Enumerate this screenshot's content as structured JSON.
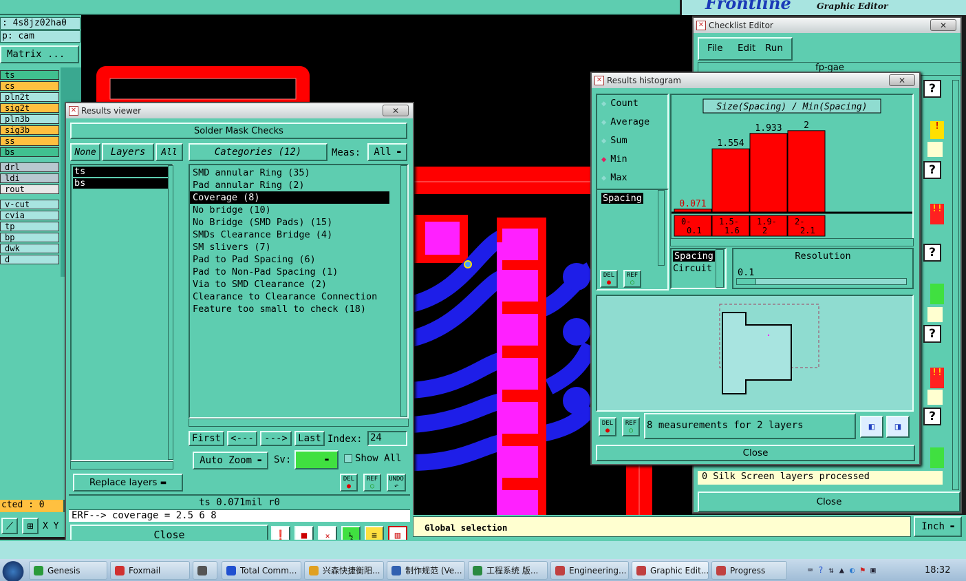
{
  "top_bar": {
    "product": "Frontline",
    "subtitle": "Graphic Editor"
  },
  "left_panel": {
    "job": ": 4s8jz02ha0",
    "step": "p: cam",
    "matrix_button": "Matrix ...",
    "layers": [
      {
        "name": "ts",
        "color": "#40c090"
      },
      {
        "name": "cs",
        "color": "#ffc040"
      },
      {
        "name": "pln2t",
        "color": "#a8e4e0"
      },
      {
        "name": "sig2t",
        "color": "#ffc040"
      },
      {
        "name": "pln3b",
        "color": "#a8e4e0"
      },
      {
        "name": "sig3b",
        "color": "#ffc040"
      },
      {
        "name": "ss",
        "color": "#ffc040"
      },
      {
        "name": "bs",
        "color": "#40c090"
      },
      {
        "name": "drl",
        "color": "#b8c8d0"
      },
      {
        "name": "ldi",
        "color": "#b8c8d0"
      },
      {
        "name": "rout",
        "color": "#e8e8e8"
      },
      {
        "name": "v-cut",
        "color": "#a8e4e0"
      },
      {
        "name": "cvia",
        "color": "#a8e4e0"
      },
      {
        "name": "tp",
        "color": "#a8e4e0"
      },
      {
        "name": "bp",
        "color": "#a8e4e0"
      },
      {
        "name": "dwk",
        "color": "#a8e4e0"
      },
      {
        "name": "d",
        "color": "#a8e4e0"
      }
    ],
    "selected_count": "cted : 0",
    "xy_label": "X Y"
  },
  "results_viewer": {
    "title": "Results viewer",
    "header": "Solder Mask Checks",
    "none_btn": "None",
    "layers_btn": "Layers",
    "all_btn": "All",
    "layers": [
      "ts",
      "bs"
    ],
    "categories_btn": "Categories (12)",
    "meas_label": "Meas:",
    "meas_value": "All",
    "categories": [
      "SMD annular Ring (35)",
      "Pad annular Ring (2)",
      "Coverage (8)",
      "No bridge (10)",
      "No Bridge (SMD Pads) (15)",
      "SMDs Clearance Bridge (4)",
      "SM slivers (7)",
      "Pad to Pad Spacing (6)",
      "Pad to Non-Pad Spacing (1)",
      "Via to SMD Clearance (2)",
      "Clearance to Clearance Connection",
      "Feature too small to check (18)"
    ],
    "selected_category": "Coverage (8)",
    "first_btn": "First",
    "prev_btn": "<---",
    "next_btn": "--->",
    "last_btn": "Last",
    "index_label": "Index:",
    "index_value": "24",
    "zoom_btn": "Auto Zoom",
    "sv_label": "Sv:",
    "show_all": "Show All",
    "replace_btn": "Replace layers",
    "del_label": "DEL",
    "ref_label": "REF",
    "undo_label": "UNDO",
    "status": "ts 0.071mil  r0",
    "erf_line": "ERF--> coverage = 2.5 6 8",
    "close_btn": "Close"
  },
  "histogram": {
    "title": "Results histogram",
    "modes": [
      "Count",
      "Average",
      "Sum",
      "Min",
      "Max"
    ],
    "selected_mode": "Min",
    "list_items": [
      "Spacing"
    ],
    "chart_title": "Size(Spacing) / Min(Spacing)",
    "chart_data": {
      "type": "bar",
      "title": "Size(Spacing) / Min(Spacing)",
      "categories": [
        "0-0.1",
        "1.5-1.6",
        "1.9-2",
        "2-2.1"
      ],
      "values": [
        0.071,
        1.554,
        1.933,
        2
      ],
      "value_labels": [
        "0.071",
        "1.554",
        "1.933",
        "2"
      ],
      "ylim": [
        0,
        2.2
      ]
    },
    "bin_labels": [
      [
        "0-",
        "0.1"
      ],
      [
        "1.5-",
        "1.6"
      ],
      [
        "1.9-",
        "2"
      ],
      [
        "2-",
        "2.1"
      ]
    ],
    "prop_items": [
      "Spacing",
      "Circuit"
    ],
    "resolution_label": "Resolution",
    "resolution_value": "0.1",
    "measurements": "8 measurements for 2 layers",
    "close_btn": "Close",
    "del_label": "DEL",
    "ref_label": "REF"
  },
  "checklist": {
    "title": "Checklist Editor",
    "menus": [
      "File",
      "Edit",
      "Run"
    ],
    "name": "fp-gae",
    "status": "0 Silk Screen layers processed",
    "close_btn": "Close"
  },
  "bottom": {
    "global_selection": "Global selection",
    "units": "Inch"
  },
  "taskbar": {
    "items": [
      "Genesis",
      "Foxmail",
      "",
      "Total Comm...",
      "兴森快捷衡阳...",
      "制作规范 (Ve...",
      "工程系统   版...",
      "Engineering...",
      "Graphic Edit...",
      "Progress"
    ],
    "clock": "18:32"
  },
  "colors": {
    "panel": "#5ecdb0",
    "canvas": "#000000",
    "pad_red": "#ff0000",
    "pad_magenta": "#ff00ff",
    "trace_blue": "#1e1ee8",
    "bar_red": "#ff0000"
  }
}
